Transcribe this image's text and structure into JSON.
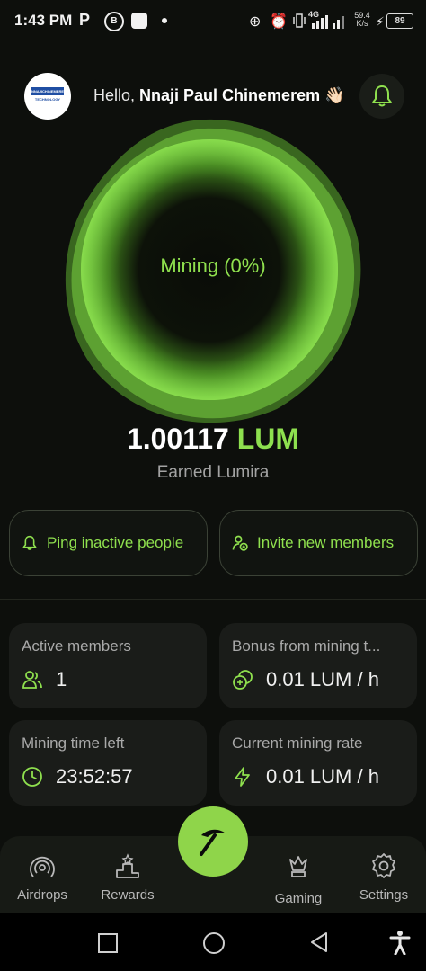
{
  "status_bar": {
    "time": "1:43 PM",
    "p_icon": "P",
    "b_icon": "B",
    "network_speed_value": "59.4",
    "network_speed_unit": "K/s",
    "network_type": "4G",
    "battery": "89"
  },
  "header": {
    "greeting_prefix": "Hello, ",
    "user_name": "Nnaji Paul Chinemerem",
    "wave_emoji": "👋🏻",
    "avatar_text": "NNAJICHINEMEREM",
    "avatar_subtext": "TECHNOLOGY"
  },
  "mining": {
    "status_label": "Mining (0%)",
    "progress_percent": 0,
    "earned_amount": "1.00117",
    "earned_unit": "LUM",
    "earned_label": "Earned Lumira"
  },
  "actions": {
    "ping_label": "Ping inactive people",
    "invite_label": "Invite new members"
  },
  "stats": {
    "active_members_title": "Active members",
    "active_members_value": "1",
    "bonus_title": "Bonus from mining t...",
    "bonus_value": "0.01 LUM / h",
    "time_left_title": "Mining time left",
    "time_left_value": "23:52:57",
    "rate_title": "Current mining rate",
    "rate_value": "0.01 LUM / h"
  },
  "nav": {
    "airdrops": "Airdrops",
    "rewards": "Rewards",
    "gaming": "Gaming",
    "settings": "Settings"
  },
  "colors": {
    "accent": "#8fe04e",
    "background": "#0d0f0c",
    "card": "#1a1c19",
    "fab": "#8fd54a"
  }
}
